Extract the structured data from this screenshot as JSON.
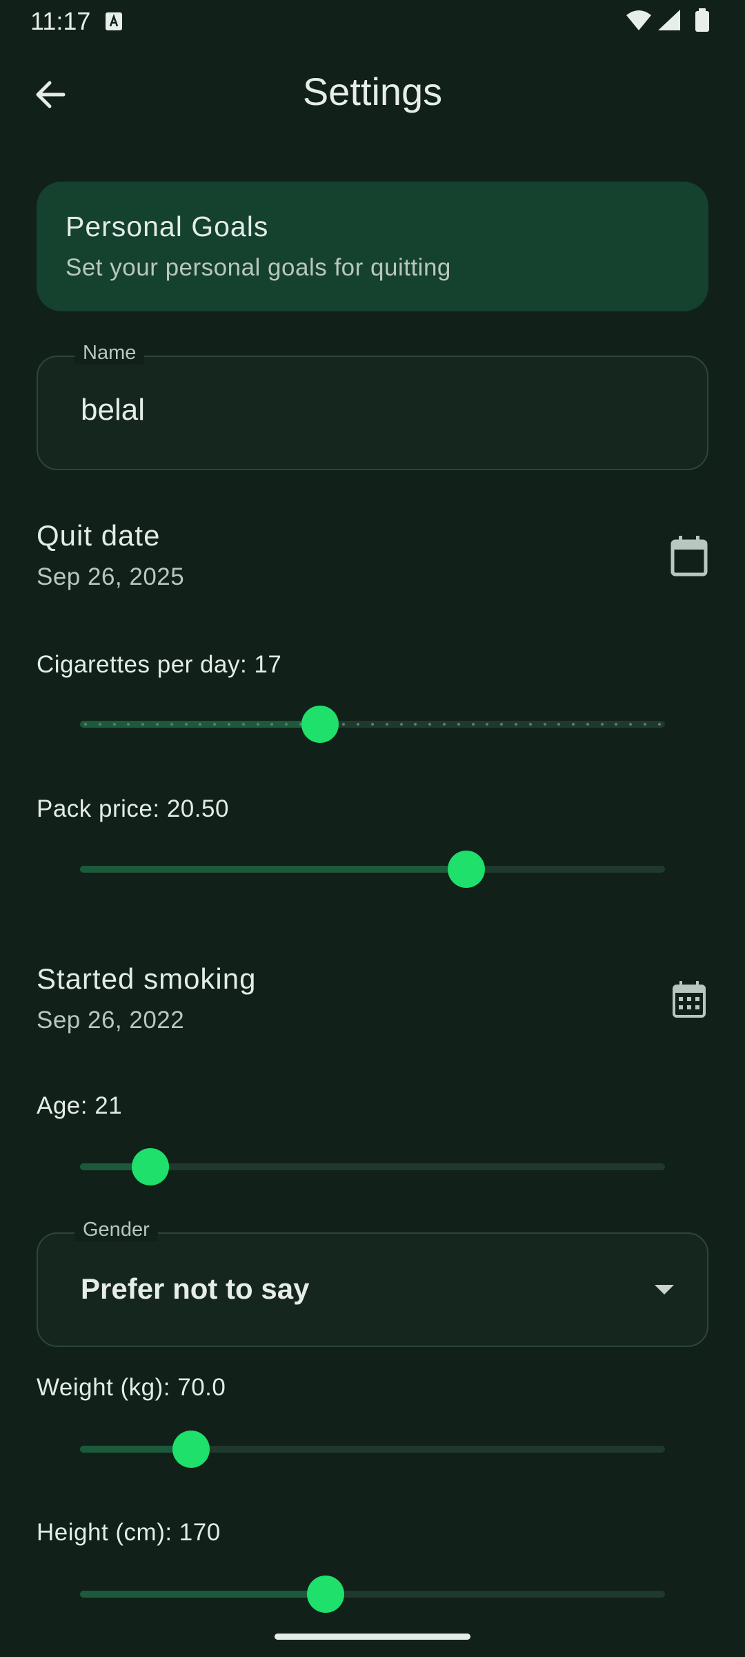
{
  "status_bar": {
    "time": "11:17"
  },
  "app_bar": {
    "title": "Settings",
    "back_icon": "arrow-back-icon"
  },
  "goals_card": {
    "title": "Personal Goals",
    "subtitle": "Set your personal goals for quitting"
  },
  "name_field": {
    "label": "Name",
    "value": "belal"
  },
  "quit_date": {
    "title": "Quit date",
    "value": "Sep 26, 2025",
    "icon": "calendar-icon"
  },
  "cigarettes": {
    "label": "Cigarettes per day: 17",
    "fraction": 0.41,
    "tick_count": 41
  },
  "pack_price": {
    "label": "Pack price: 20.50",
    "fraction": 0.66
  },
  "started_smoking": {
    "title": "Started smoking",
    "value": "Sep 26, 2022",
    "icon": "calendar-month-icon"
  },
  "age": {
    "label": "Age: 21",
    "fraction": 0.12
  },
  "gender_field": {
    "label": "Gender",
    "value": "Prefer not to say",
    "icon": "dropdown-arrow-icon"
  },
  "weight": {
    "label": "Weight (kg): 70.0",
    "fraction": 0.19
  },
  "height": {
    "label": "Height (cm): 170",
    "fraction": 0.42
  },
  "colors": {
    "background": "#112019",
    "card": "#15412f",
    "accent": "#1ee06b",
    "track_active": "#1c5a3c",
    "track_inactive": "#1f3a2d"
  }
}
